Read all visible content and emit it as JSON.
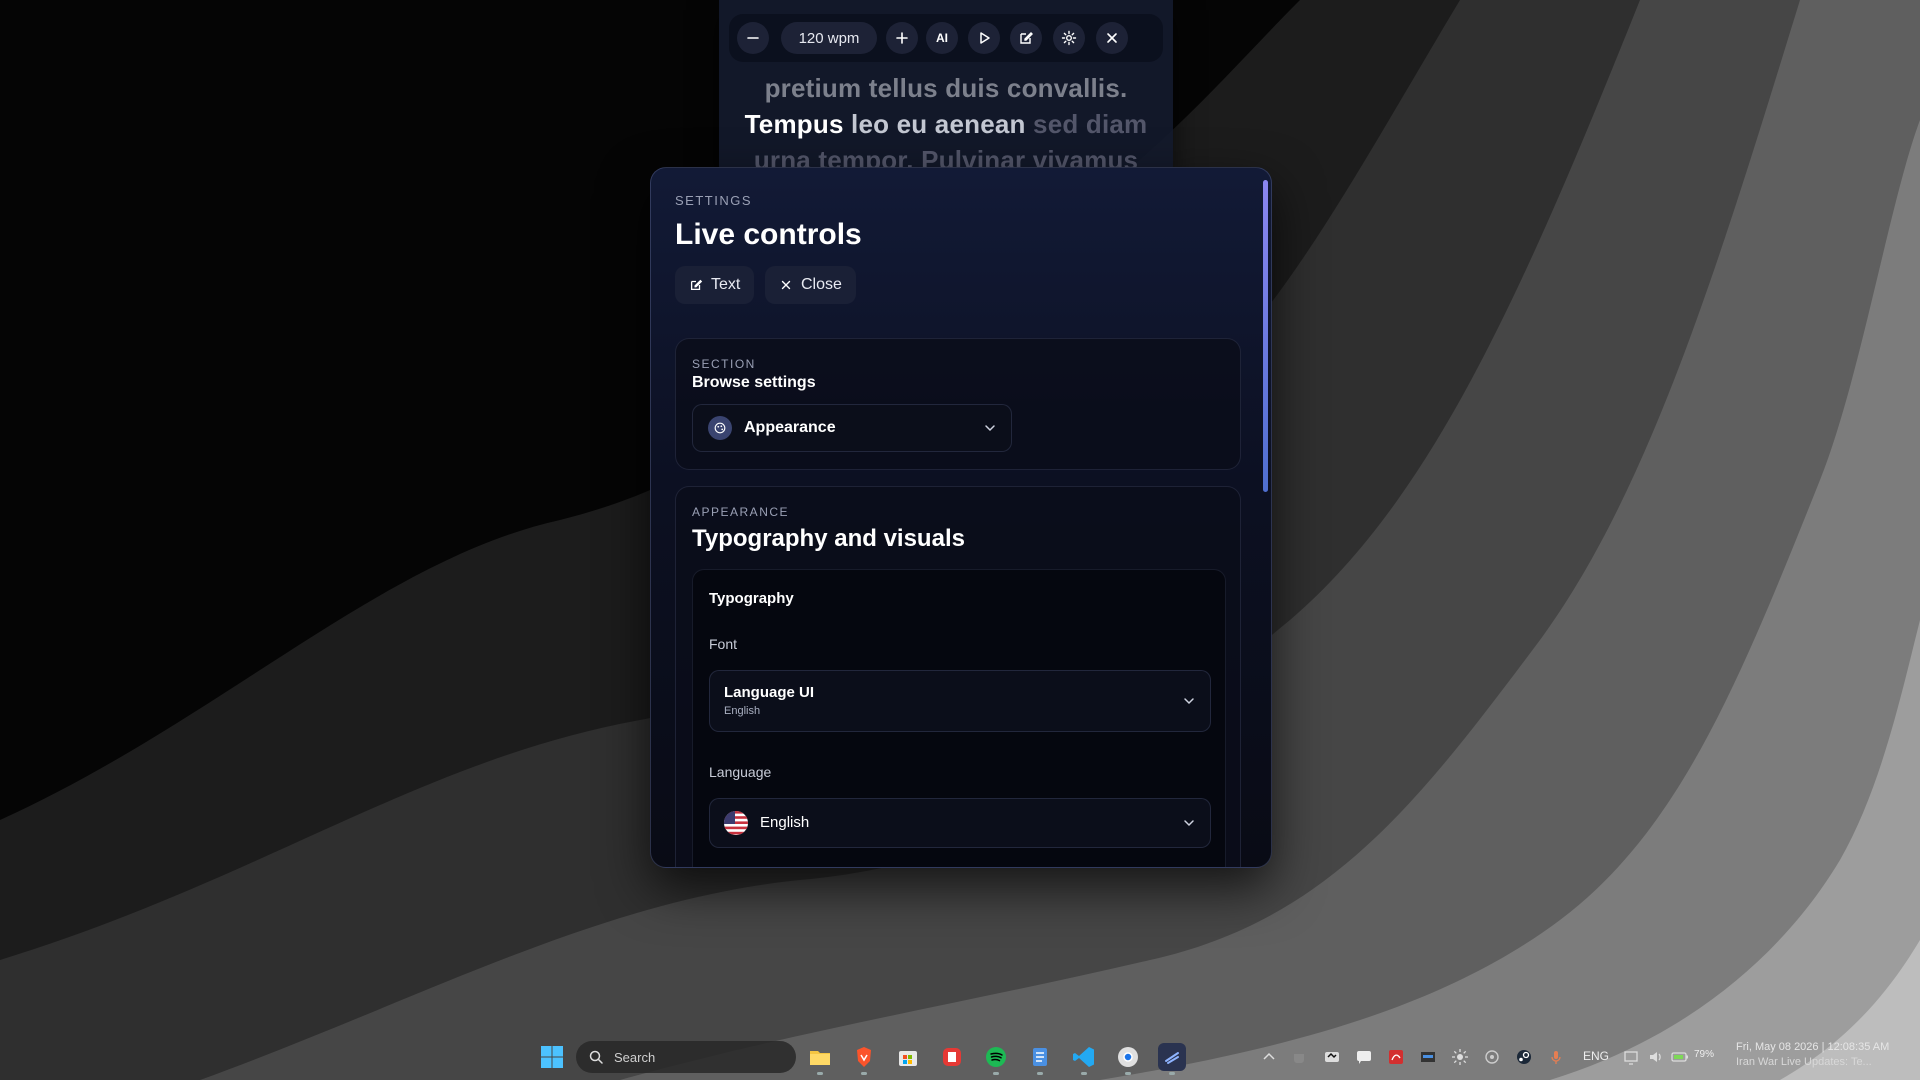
{
  "reader": {
    "speed": "120 wpm",
    "ai_label": "AI",
    "lines": [
      [
        {
          "t": "pretium tellus duis convallis.",
          "c": "dim"
        }
      ],
      [
        {
          "t": "Tempus",
          "c": "cur"
        },
        {
          "t": " leo eu aenean ",
          "c": "near"
        },
        {
          "t": "sed diam",
          "c": "dimmer"
        }
      ],
      [
        {
          "t": "urna tempor. Pulvinar vivamus",
          "c": "dimmer"
        }
      ]
    ]
  },
  "panel": {
    "eyebrow": "SETTINGS",
    "title": "Live controls",
    "text_button": "Text",
    "close_button": "Close",
    "section": {
      "eyebrow": "SECTION",
      "subtitle": "Browse settings",
      "selected": "Appearance"
    },
    "appearance": {
      "eyebrow": "APPEARANCE",
      "title": "Typography and visuals",
      "group_title": "Typography",
      "font_label": "Font",
      "font_value": "Language UI",
      "font_sub": "English",
      "language_label": "Language",
      "language_value": "English"
    }
  },
  "taskbar": {
    "search_placeholder": "Search",
    "lang": "ENG",
    "battery": "79%",
    "clock_line1": "Fri, May 08 2026 | 12:08:35 AM",
    "clock_line2": "Iran War Live Updates: Te..."
  }
}
